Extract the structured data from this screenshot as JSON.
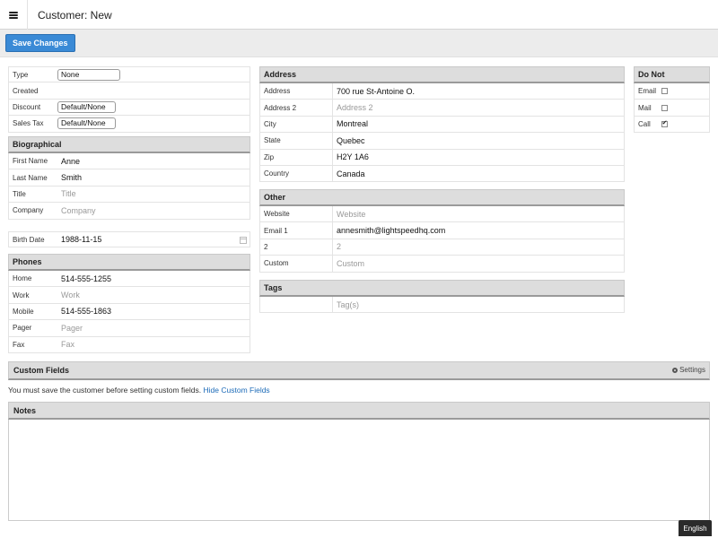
{
  "header": {
    "title": "Customer: New",
    "menu_icon": "hamburger-menu-icon"
  },
  "toolbar": {
    "save_label": "Save Changes"
  },
  "basic": {
    "type_label": "Type",
    "type_value": "None",
    "created_label": "Created",
    "discount_label": "Discount",
    "discount_value": "Default/None",
    "salestax_label": "Sales Tax",
    "salestax_value": "Default/None"
  },
  "biographical": {
    "heading": "Biographical",
    "first_name_label": "First Name",
    "first_name_value": "Anne",
    "last_name_label": "Last Name",
    "last_name_value": "Smith",
    "title_label": "Title",
    "title_placeholder": "Title",
    "company_label": "Company",
    "company_placeholder": "Company"
  },
  "birth": {
    "label": "Birth Date",
    "value": "1988-11-15"
  },
  "phones": {
    "heading": "Phones",
    "home_label": "Home",
    "home_value": "514-555-1255",
    "work_label": "Work",
    "work_placeholder": "Work",
    "mobile_label": "Mobile",
    "mobile_value": "514-555-1863",
    "pager_label": "Pager",
    "pager_placeholder": "Pager",
    "fax_label": "Fax",
    "fax_placeholder": "Fax"
  },
  "address": {
    "heading": "Address",
    "address_label": "Address",
    "address_value": "700 rue St-Antoine O.",
    "address2_label": "Address 2",
    "address2_placeholder": "Address 2",
    "city_label": "City",
    "city_value": "Montreal",
    "state_label": "State",
    "state_value": "Quebec",
    "zip_label": "Zip",
    "zip_value": "H2Y 1A6",
    "country_label": "Country",
    "country_value": "Canada"
  },
  "other": {
    "heading": "Other",
    "website_label": "Website",
    "website_placeholder": "Website",
    "email1_label": "Email 1",
    "email1_value": "annesmith@lightspeedhq.com",
    "email2_label": "2",
    "email2_placeholder": "2",
    "custom_label": "Custom",
    "custom_placeholder": "Custom"
  },
  "tags": {
    "heading": "Tags",
    "placeholder": "Tag(s)"
  },
  "donot": {
    "heading": "Do Not",
    "email_label": "Email",
    "email_checked": false,
    "mail_label": "Mail",
    "mail_checked": false,
    "call_label": "Call",
    "call_checked": true,
    "check_mark": "✔"
  },
  "custom_fields": {
    "heading": "Custom Fields",
    "settings_label": "Settings",
    "message": "You must save the customer before setting custom fields.",
    "hide_link": "Hide Custom Fields"
  },
  "notes": {
    "heading": "Notes"
  },
  "footer": {
    "language": "English"
  },
  "colors": {
    "accent": "#3a8ad6",
    "link": "#1d6bb8"
  }
}
